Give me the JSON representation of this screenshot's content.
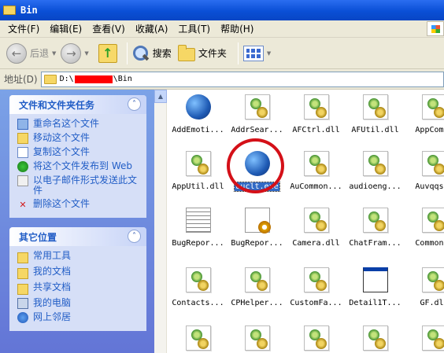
{
  "window": {
    "title": "Bin"
  },
  "menu": [
    "文件(F)",
    "编辑(E)",
    "查看(V)",
    "收藏(A)",
    "工具(T)",
    "帮助(H)"
  ],
  "toolbar": {
    "back_label": "后退",
    "search_label": "搜索",
    "folders_label": "文件夹"
  },
  "address": {
    "label": "地址(D)",
    "path_prefix": "D:\\",
    "path_suffix": "\\Bin"
  },
  "sidebar": {
    "file_tasks": {
      "title": "文件和文件夹任务",
      "items": [
        "重命名这个文件",
        "移动这个文件",
        "复制这个文件",
        "将这个文件发布到 Web",
        "以电子邮件形式发送此文件",
        "删除这个文件"
      ]
    },
    "other_places": {
      "title": "其它位置",
      "items": [
        "常用工具",
        "我的文档",
        "共享文档",
        "我的电脑",
        "网上邻居"
      ]
    }
  },
  "files": [
    {
      "name": "AddEmoti...",
      "icon": "exe-globe-icon"
    },
    {
      "name": "AddrSear...",
      "icon": "dll-icon"
    },
    {
      "name": "AFCtrl.dll",
      "icon": "dll-icon"
    },
    {
      "name": "AFUtil.dll",
      "icon": "dll-icon"
    },
    {
      "name": "AppCom.d",
      "icon": "dll-icon"
    },
    {
      "name": "AppUtil.dll",
      "icon": "dll-icon"
    },
    {
      "name": "auclt.exe",
      "icon": "exe-globe-icon",
      "selected": true
    },
    {
      "name": "AuCommon...",
      "icon": "dll-icon"
    },
    {
      "name": "audioeng...",
      "icon": "dll-icon"
    },
    {
      "name": "Auvqqsdl",
      "icon": "dll-icon"
    },
    {
      "name": "BugRepor...",
      "icon": "text-file-icon"
    },
    {
      "name": "BugRepor...",
      "icon": "config-file-icon"
    },
    {
      "name": "Camera.dll",
      "icon": "dll-icon"
    },
    {
      "name": "ChatFram...",
      "icon": "dll-icon"
    },
    {
      "name": "Common.d",
      "icon": "dll-icon"
    },
    {
      "name": "Contacts...",
      "icon": "dll-icon"
    },
    {
      "name": "CPHelper...",
      "icon": "dll-icon"
    },
    {
      "name": "CustomFa...",
      "icon": "dll-icon"
    },
    {
      "name": "Detail1T...",
      "icon": "app-window-icon"
    },
    {
      "name": "GF.dll",
      "icon": "dll-icon"
    }
  ]
}
